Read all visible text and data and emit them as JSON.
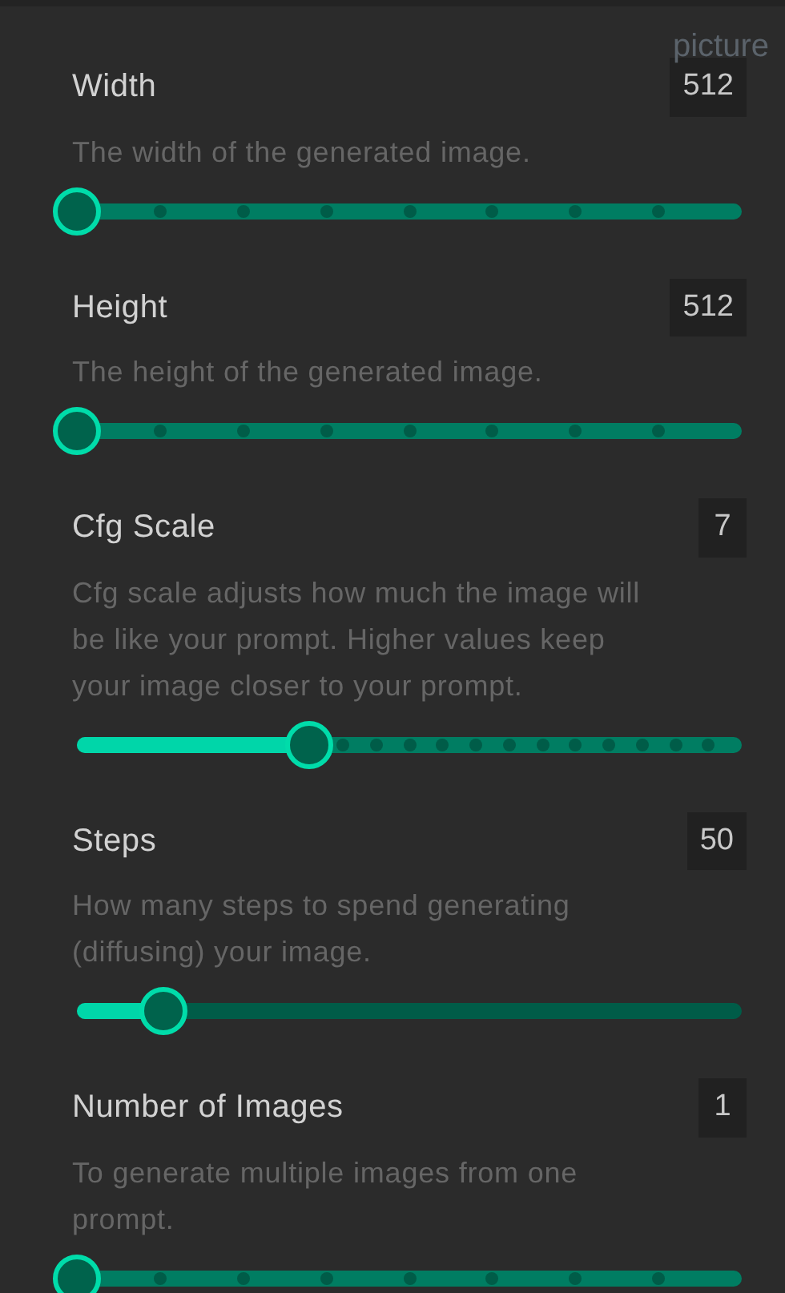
{
  "overflow_text": "picture",
  "settings": [
    {
      "title": "Width",
      "value": "512",
      "description": "The width of the generated image.",
      "kind": "coarse",
      "level": 0
    },
    {
      "title": "Height",
      "value": "512",
      "description": "The height of the generated image.",
      "kind": "coarse",
      "level": 0
    },
    {
      "title": "Cfg Scale",
      "value": "7",
      "description": "Cfg scale adjusts how much the image will be like your prompt. Higher values keep your image closer to your prompt.",
      "kind": "fine",
      "level": 0.35
    },
    {
      "title": "Steps",
      "value": "50",
      "description": "How many steps to spend generating (diffusing) your image.",
      "kind": "smooth",
      "level": 0.13
    },
    {
      "title": "Number of Images",
      "value": "1",
      "description": "To generate multiple images from one prompt.",
      "kind": "coarse",
      "level": 0
    }
  ]
}
